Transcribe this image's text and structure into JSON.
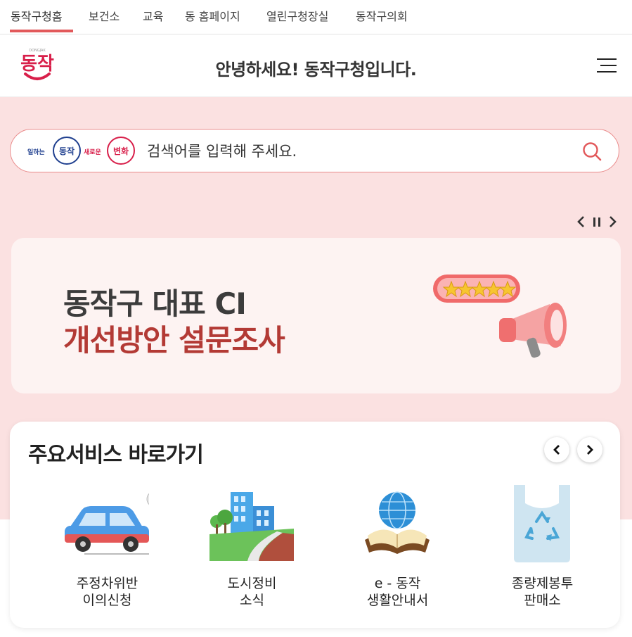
{
  "topnav": {
    "tabs": [
      {
        "label": "동작구청홈",
        "active": true
      },
      {
        "label": "보건소"
      },
      {
        "label": "교육"
      },
      {
        "label": "동 홈페이지"
      },
      {
        "label": "열린구청장실"
      },
      {
        "label": "동작구의회"
      }
    ]
  },
  "header": {
    "logo_text": "동작",
    "logo_sub": "DONGJAK",
    "title": "안녕하세요! 동작구청입니다."
  },
  "search": {
    "badge_text_1": "일하는",
    "badge_text_2": "동작",
    "badge_text_3": "새로운",
    "badge_text_4": "변화",
    "placeholder": "검색어를 입력해 주세요."
  },
  "banner": {
    "line1": "동작구 대표 CI",
    "line2": "개선방안 설문조사"
  },
  "services": {
    "title": "주요서비스 바로가기",
    "items": [
      {
        "label": "주정차위반\n이의신청",
        "icon": "car-icon"
      },
      {
        "label": "도시정비\n소식",
        "icon": "city-icon"
      },
      {
        "label": "e - 동작\n생활안내서",
        "icon": "globe-book-icon"
      },
      {
        "label": "종량제봉투\n판매소",
        "icon": "recycle-bag-icon"
      }
    ]
  },
  "colors": {
    "accent": "#e2595b",
    "hero_bg": "#fbe1e1",
    "banner_red": "#b33a35"
  }
}
